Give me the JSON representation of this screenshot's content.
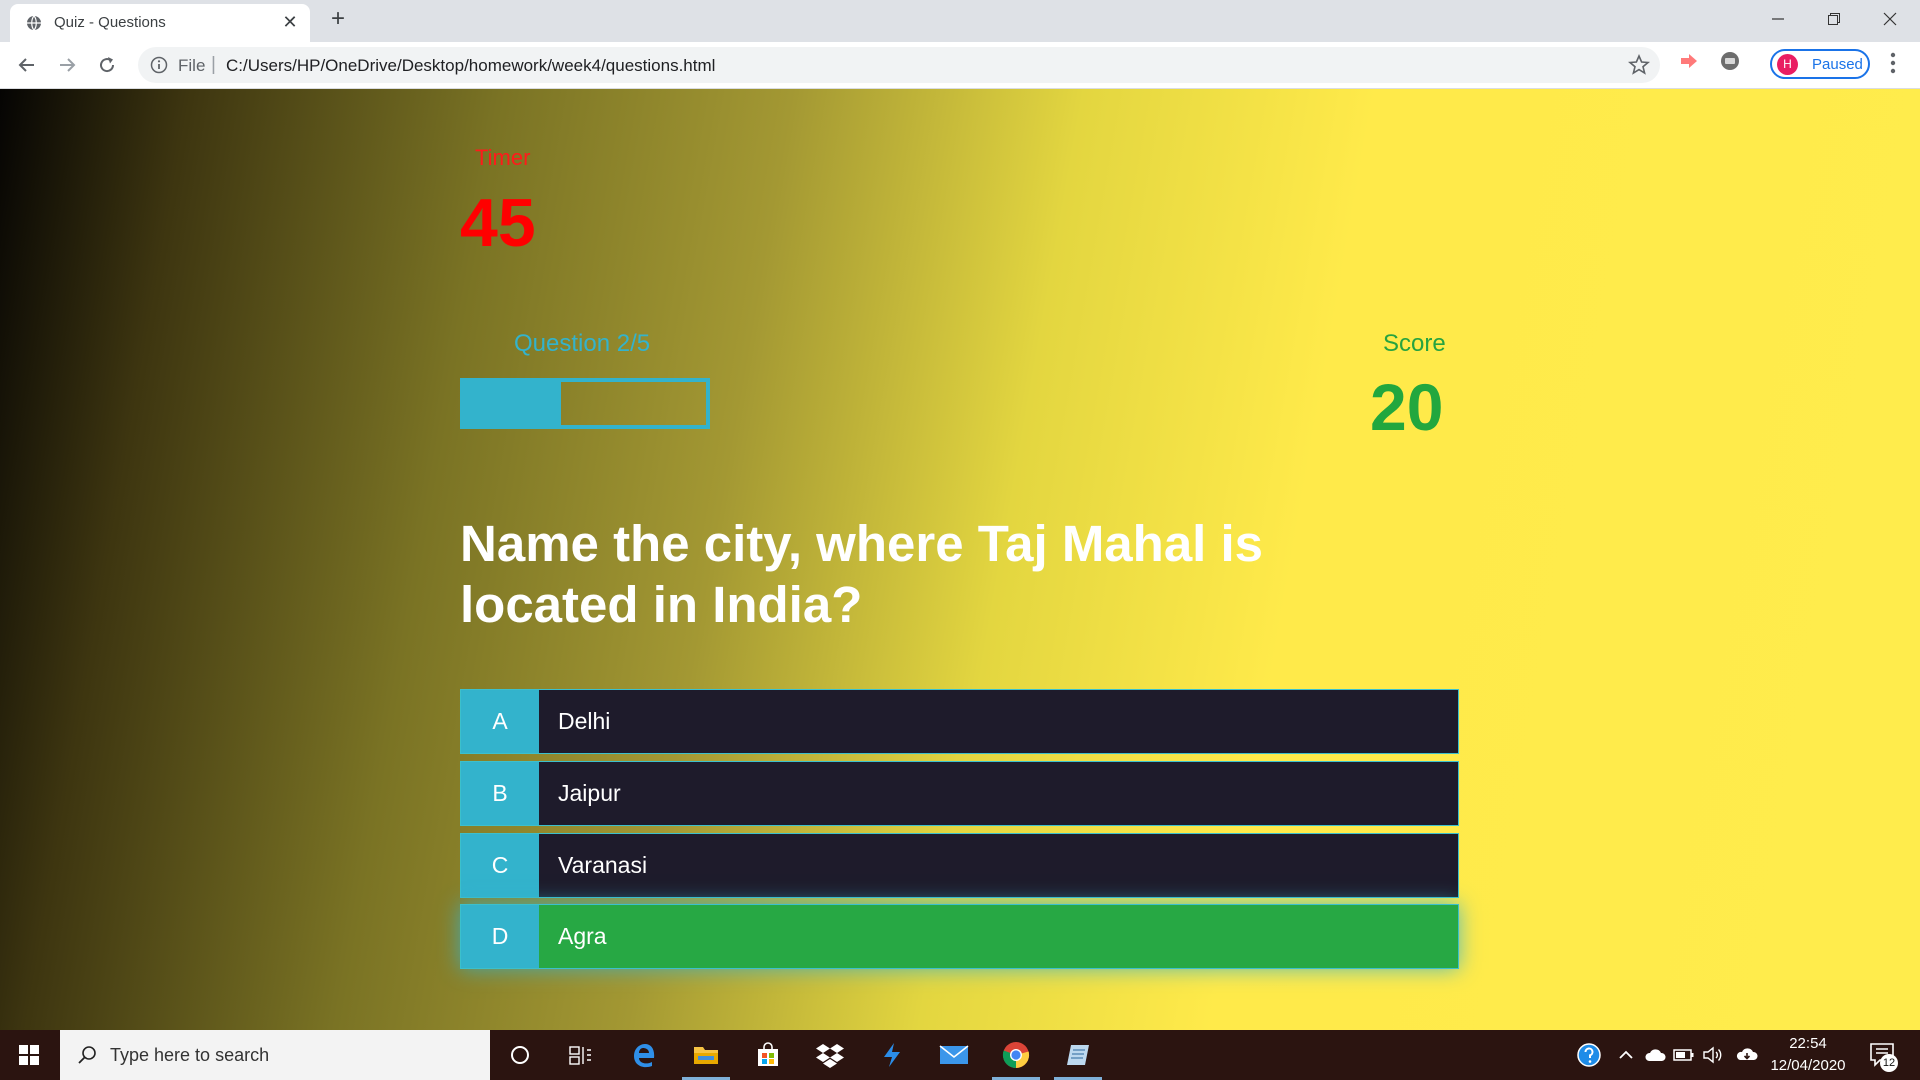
{
  "browser": {
    "tab_title": "Quiz - Questions",
    "url_scheme": "File",
    "url_path": "C:/Users/HP/OneDrive/Desktop/homework/week4/questions.html",
    "profile_initial": "H",
    "profile_status": "Paused"
  },
  "quiz": {
    "timer_label": "Timer",
    "timer_value": "45",
    "progress_label": "Question 2/5",
    "progress_fraction": 0.4,
    "score_label": "Score",
    "score_value": "20",
    "question": "Name the city, where Taj Mahal is located in India?",
    "choices": [
      {
        "prefix": "A",
        "text": "Delhi"
      },
      {
        "prefix": "B",
        "text": "Jaipur"
      },
      {
        "prefix": "C",
        "text": "Varanasi"
      },
      {
        "prefix": "D",
        "text": "Agra"
      }
    ],
    "correct_choice": "D"
  },
  "taskbar": {
    "search_placeholder": "Type here to search",
    "time": "22:54",
    "date": "12/04/2020",
    "notification_count": "12"
  },
  "colors": {
    "timer": "#ff0000",
    "accent": "#33b3cc",
    "score": "#22a73e",
    "correct": "#27a844",
    "choice_bg": "#1e1b2b"
  },
  "icons": {
    "tab_favicon": "globe-icon",
    "window_controls": [
      "minimize-icon",
      "restore-icon",
      "close-icon"
    ],
    "nav": [
      "back-arrow-icon",
      "forward-arrow-icon",
      "reload-icon"
    ],
    "taskbar": [
      "windows-start-icon",
      "cortana-icon",
      "task-view-icon",
      "edge-icon",
      "file-explorer-icon",
      "store-icon",
      "dropbox-icon",
      "visual-studio-icon",
      "mail-icon",
      "chrome-icon",
      "notepad-icon"
    ]
  }
}
